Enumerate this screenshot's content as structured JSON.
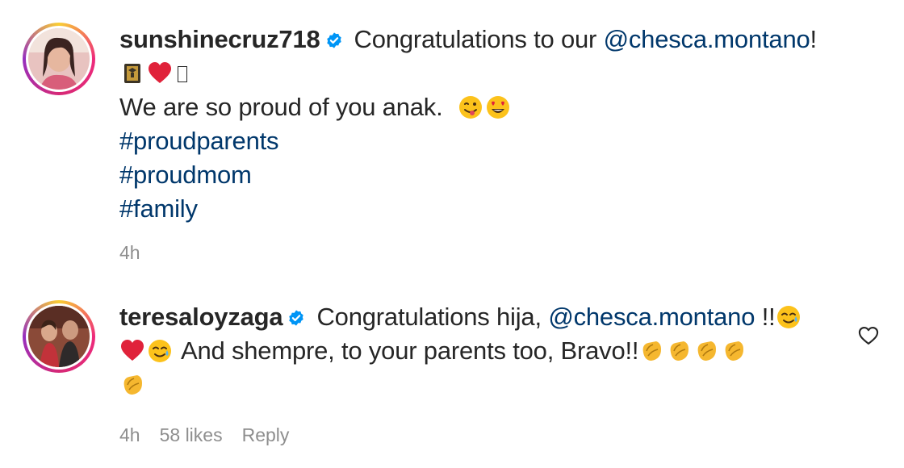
{
  "comments": [
    {
      "username": "sunshinecruz718",
      "text_intro": "Congratulations to our",
      "mention": "@chesca.montano",
      "mention_suffix": "!",
      "line3": "We are so proud of you anak.",
      "hashtags": [
        "#proudparents",
        "#proudmom",
        "#family"
      ],
      "time": "4h",
      "emojis_line2": [
        "graduation-cap-icon",
        "red-heart-icon",
        "unknown-glyph-box"
      ],
      "emojis_line3": [
        "face-savoring-icon",
        "heart-eyes-icon"
      ]
    },
    {
      "username": "teresaloyzaga",
      "text_intro": "Congratulations hija,",
      "mention": "@chesca.montano",
      "mention_suffix": "!!",
      "line2_text": "And shempre, to your parents too, Bravo!!",
      "time": "4h",
      "likes": "58 likes",
      "reply": "Reply"
    }
  ],
  "colors": {
    "text": "#262626",
    "link": "#00376b",
    "meta": "#8e8e8e",
    "verified": "#0095f6"
  }
}
